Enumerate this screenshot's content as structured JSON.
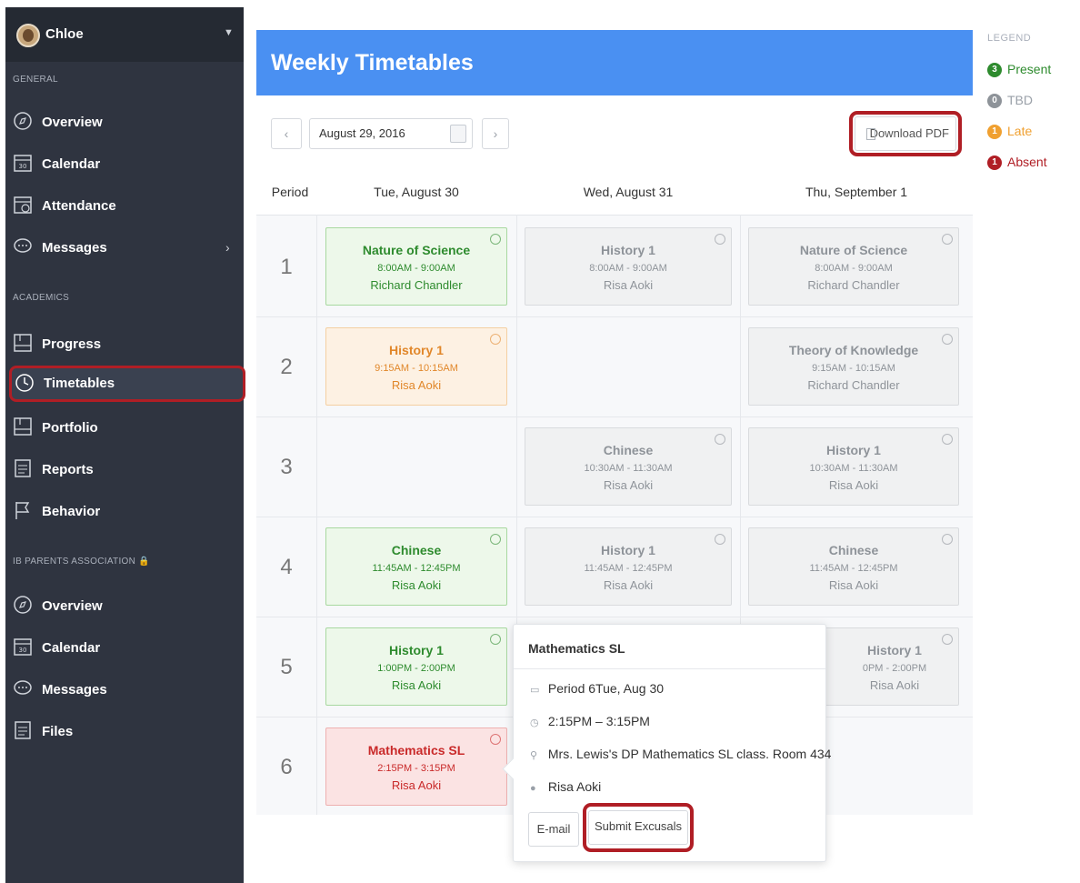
{
  "sidebar": {
    "user": "Chloe",
    "sections": {
      "general": "GENERAL",
      "academics": "ACADEMICS",
      "association": "IB PARENTS ASSOCIATION"
    },
    "general_items": [
      "Overview",
      "Calendar",
      "Attendance",
      "Messages"
    ],
    "academic_items": [
      "Progress",
      "Timetables",
      "Portfolio",
      "Reports",
      "Behavior"
    ],
    "association_items": [
      "Overview",
      "Calendar",
      "Messages",
      "Files"
    ]
  },
  "header": {
    "title": "Weekly Timetables"
  },
  "toolbar": {
    "prev": "‹",
    "next": "›",
    "date": "August 29, 2016",
    "download_pdf": "Download PDF"
  },
  "columns": {
    "period": "Period",
    "days": [
      "Tue, August 30",
      "Wed, August 31",
      "Thu, September 1"
    ]
  },
  "periods": [
    "1",
    "2",
    "3",
    "4",
    "5",
    "6"
  ],
  "classes": {
    "p1_tue": {
      "title": "Nature of Science",
      "time": "8:00AM - 9:00AM",
      "teacher": "Richard Chandler"
    },
    "p1_wed": {
      "title": "History 1",
      "time": "8:00AM - 9:00AM",
      "teacher": "Risa Aoki"
    },
    "p1_thu": {
      "title": "Nature of Science",
      "time": "8:00AM - 9:00AM",
      "teacher": "Richard Chandler"
    },
    "p2_tue": {
      "title": "History 1",
      "time": "9:15AM - 10:15AM",
      "teacher": "Risa Aoki"
    },
    "p2_thu": {
      "title": "Theory of Knowledge",
      "time": "9:15AM - 10:15AM",
      "teacher": "Richard Chandler"
    },
    "p3_wed": {
      "title": "Chinese",
      "time": "10:30AM - 11:30AM",
      "teacher": "Risa Aoki"
    },
    "p3_thu": {
      "title": "History 1",
      "time": "10:30AM - 11:30AM",
      "teacher": "Risa Aoki"
    },
    "p4_tue": {
      "title": "Chinese",
      "time": "11:45AM - 12:45PM",
      "teacher": "Risa Aoki"
    },
    "p4_wed": {
      "title": "History 1",
      "time": "11:45AM - 12:45PM",
      "teacher": "Risa Aoki"
    },
    "p4_thu": {
      "title": "Chinese",
      "time": "11:45AM - 12:45PM",
      "teacher": "Risa Aoki"
    },
    "p5_tue": {
      "title": "History 1",
      "time": "1:00PM - 2:00PM",
      "teacher": "Risa Aoki"
    },
    "p5_thu": {
      "title": "History 1",
      "time": "0PM - 2:00PM",
      "teacher": "Risa Aoki"
    },
    "p6_tue": {
      "title": "Mathematics SL",
      "time": "2:15PM - 3:15PM",
      "teacher": "Risa Aoki"
    }
  },
  "legend": {
    "heading": "LEGEND",
    "items": [
      {
        "count": "3",
        "label": "Present",
        "color": "#2e8b2e"
      },
      {
        "count": "0",
        "label": "TBD",
        "color": "#8e9399"
      },
      {
        "count": "1",
        "label": "Late",
        "color": "#f0a030"
      },
      {
        "count": "1",
        "label": "Absent",
        "color": "#b01e25"
      }
    ]
  },
  "popup": {
    "title": "Mathematics SL",
    "period": "Period 6Tue, Aug 30",
    "time": "2:15PM – 3:15PM",
    "location": "Mrs. Lewis's DP Mathematics SL class. Room 434",
    "teacher": "Risa Aoki",
    "email_btn": "E-mail",
    "excuse_btn": "Submit Excusals"
  },
  "colors": {
    "sidebar_bg": "#2f3440",
    "header_bg": "#4a90f2",
    "highlight_red": "#b01e25"
  }
}
